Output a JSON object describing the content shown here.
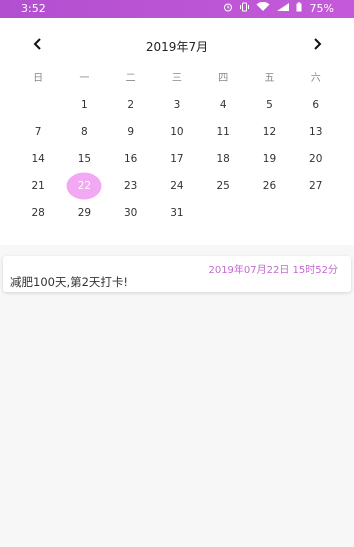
{
  "statusbar": {
    "time": "3:52",
    "battery": "75%",
    "icons": [
      "alarm-icon",
      "vibrate-icon",
      "wifi-icon",
      "signal-icon",
      "battery-icon"
    ]
  },
  "calendar": {
    "title": "2019年7月",
    "prev_icon": "chevron-left",
    "next_icon": "chevron-right",
    "weekdays": [
      "日",
      "一",
      "二",
      "三",
      "四",
      "五",
      "六"
    ],
    "weeks": [
      [
        "",
        "1",
        "2",
        "3",
        "4",
        "5",
        "6"
      ],
      [
        "7",
        "8",
        "9",
        "10",
        "11",
        "12",
        "13"
      ],
      [
        "14",
        "15",
        "16",
        "17",
        "18",
        "19",
        "20"
      ],
      [
        "21",
        "22",
        "23",
        "24",
        "25",
        "26",
        "27"
      ],
      [
        "28",
        "29",
        "30",
        "31",
        "",
        "",
        ""
      ]
    ],
    "selected_day": "22",
    "selected_color": "#f3a8f4"
  },
  "entry": {
    "timestamp": "2019年07月22日 15时52分",
    "text": "减肥100天,第2天打卡!",
    "accent_color": "#c46ad0"
  }
}
